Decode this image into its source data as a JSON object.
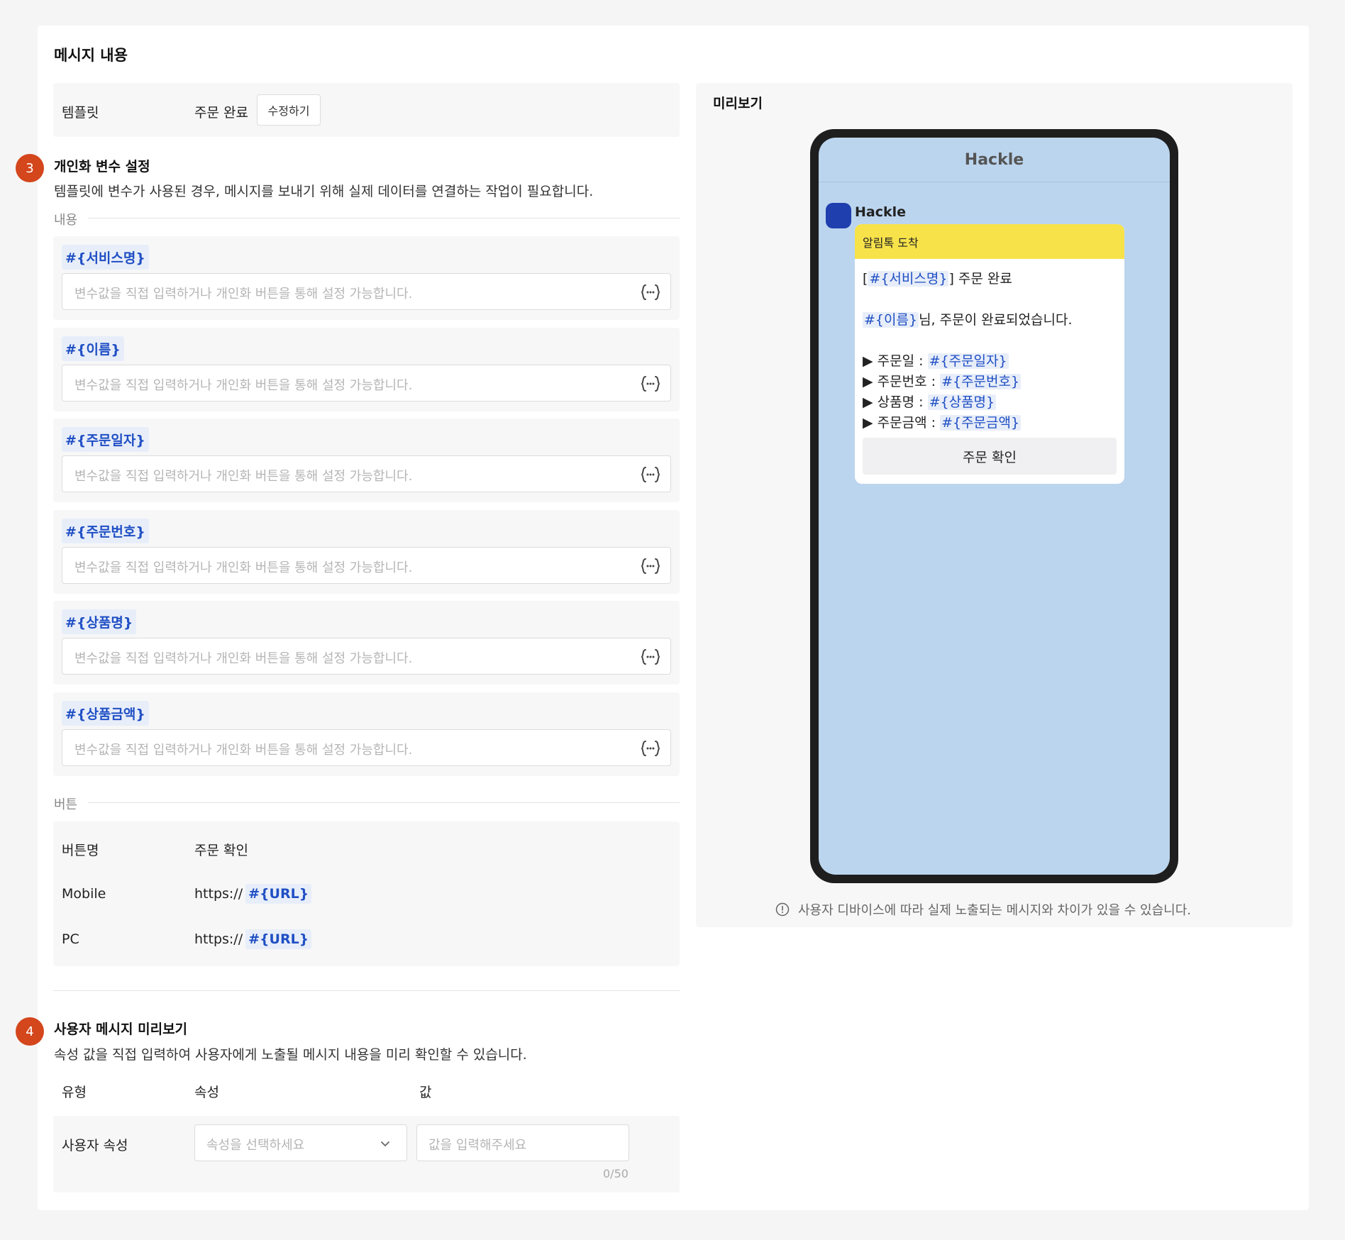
{
  "section_title": "메시지 내용",
  "template": {
    "label": "템플릿",
    "value": "주문 완료",
    "edit_label": "수정하기"
  },
  "step3": {
    "number": "3",
    "title": "개인화 변수 설정",
    "desc": "템플릿에 변수가 사용된 경우, 메시지를 보내기 위해 실제 데이터를 연결하는 작업이 필요합니다.",
    "content_label": "내용",
    "placeholder": "변수값을 직접 입력하거나 개인화 버튼을 통해 설정 가능합니다.",
    "variables": [
      "#{서비스명}",
      "#{이름}",
      "#{주문일자}",
      "#{주문번호}",
      "#{상품명}",
      "#{상품금액}"
    ],
    "button_label": "버튼",
    "button_rows": {
      "name_label": "버튼명",
      "name_value": "주문 확인",
      "mobile_label": "Mobile",
      "mobile_prefix": "https://",
      "mobile_var": "#{URL}",
      "pc_label": "PC",
      "pc_prefix": "https://",
      "pc_var": "#{URL}"
    }
  },
  "step4": {
    "number": "4",
    "title": "사용자 메시지 미리보기",
    "desc": "속성 값을 직접 입력하여 사용자에게 노출될 메시지 내용을 미리 확인할 수 있습니다.",
    "col_type": "유형",
    "col_attr": "속성",
    "col_value": "값",
    "row_label": "사용자 속성",
    "select_placeholder": "속성을 선택하세요",
    "value_placeholder": "값을 입력해주세요",
    "counter": "0/50"
  },
  "preview": {
    "title": "미리보기",
    "app_name": "Hackle",
    "sender": "Hackle",
    "bubble_header": "알림톡 도착",
    "line1_open": "[",
    "line1_var": "#{서비스명}",
    "line1_close": "] 주문 완료",
    "line2_var": "#{이름}",
    "line2_text": "님, 주문이 완료되었습니다.",
    "item1_label": "▶ 주문일 : ",
    "item1_var": "#{주문일자}",
    "item2_label": "▶ 주문번호 : ",
    "item2_var": "#{주문번호}",
    "item3_label": "▶ 상품명 : ",
    "item3_var": "#{상품명}",
    "item4_label": "▶ 주문금액 : ",
    "item4_var": "#{주문금액}",
    "button": "주문 확인",
    "note": "사용자 디바이스에 따라 실제 노출되는 메시지와 차이가 있을 수 있습니다."
  },
  "colors": {
    "accent": "#1f4fc4",
    "step_badge": "#d4461c",
    "bubble_header": "#f7e24a",
    "chat_bg": "#bcd5ee"
  }
}
